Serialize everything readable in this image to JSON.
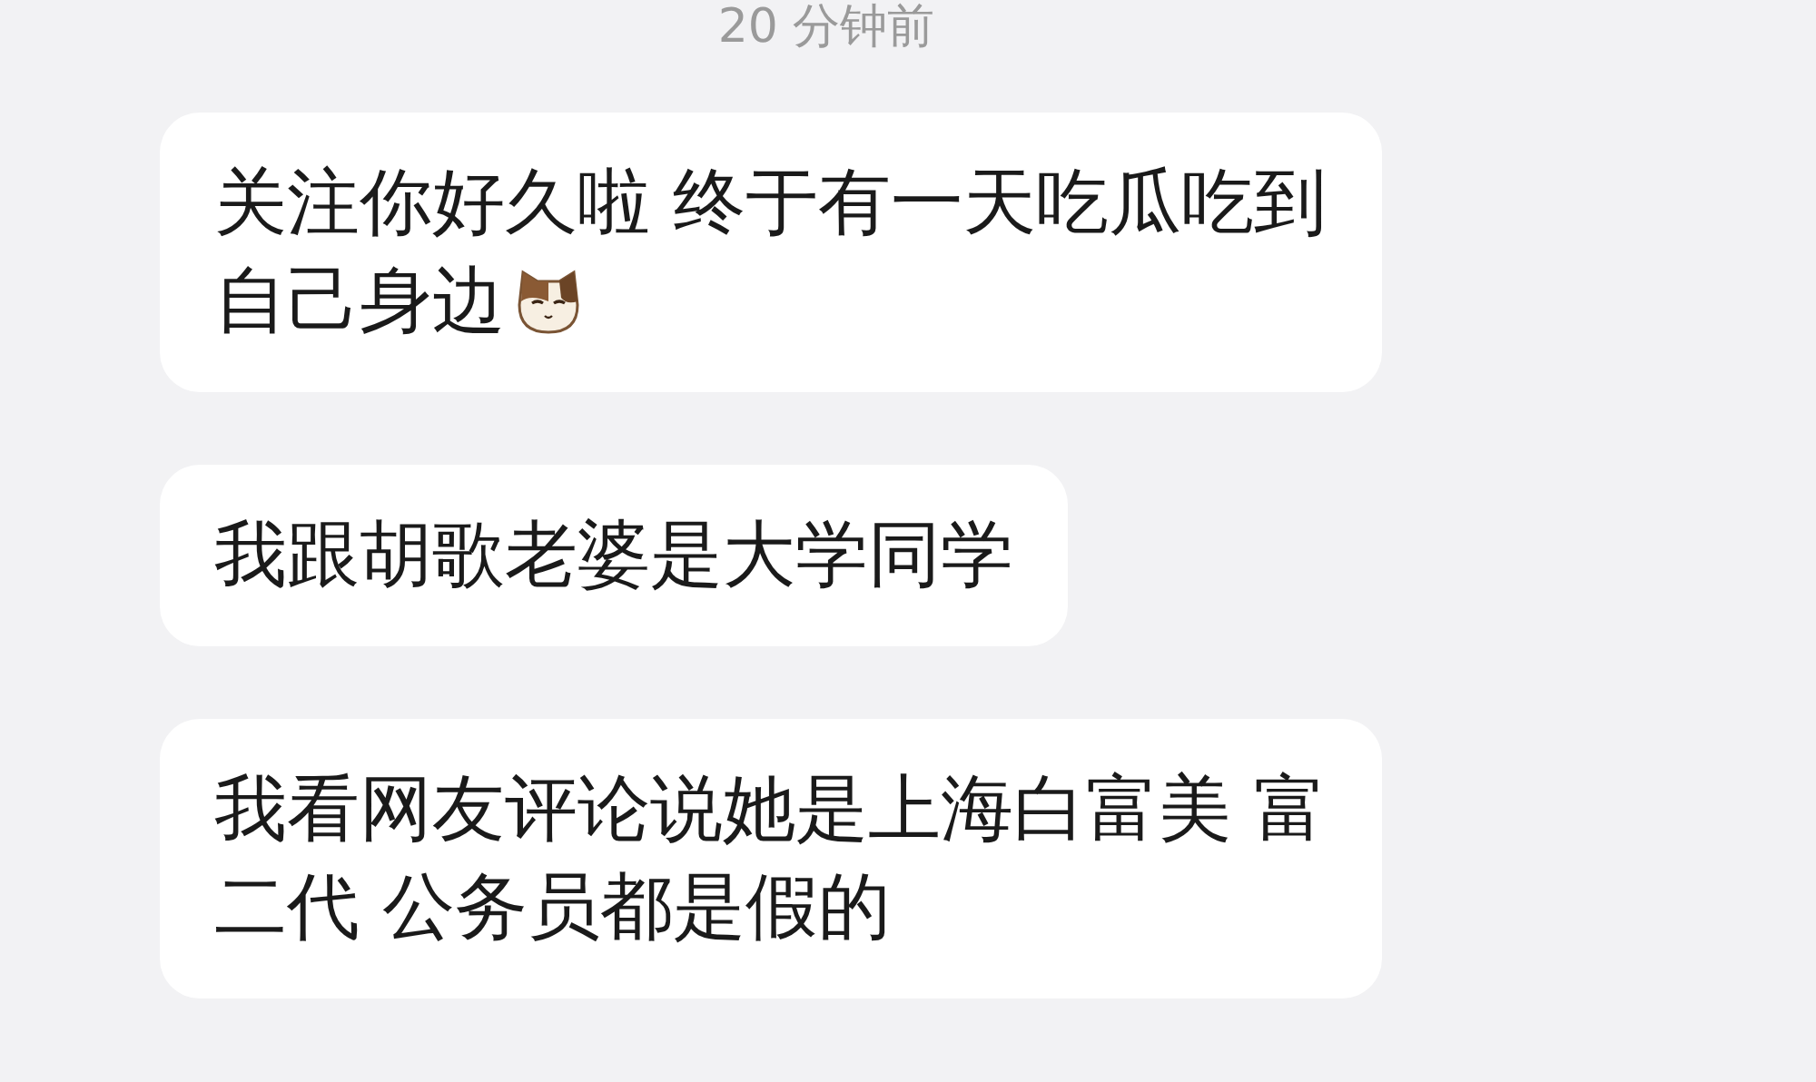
{
  "timestamp": "20 分钟前",
  "messages": [
    {
      "lines": [
        "关注你好久啦 终于有一天吃瓜吃到",
        "自己身边"
      ],
      "emoji": true
    },
    {
      "lines": [
        "我跟胡歌老婆是大学同学"
      ],
      "emoji": false
    },
    {
      "lines": [
        "我看网友评论说她是上海白富美 富",
        "二代 公务员都是假的"
      ],
      "emoji": false
    }
  ]
}
